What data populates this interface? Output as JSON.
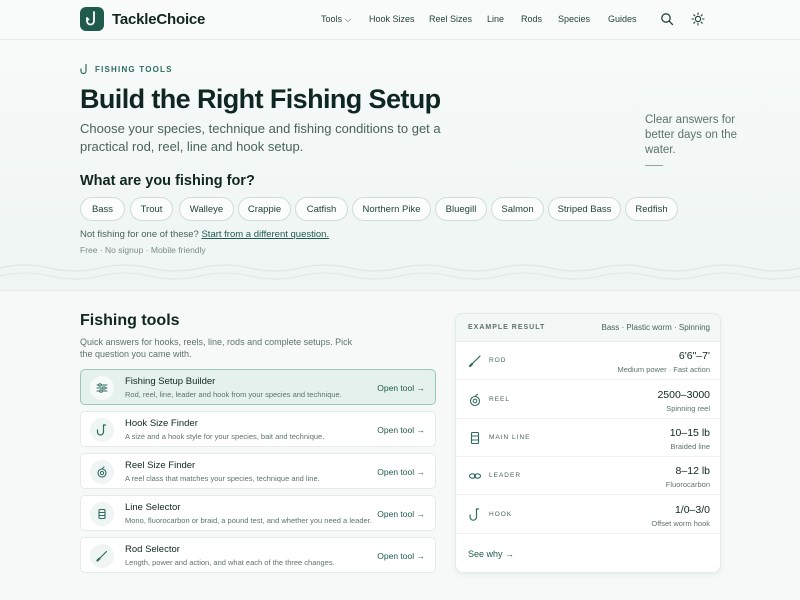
{
  "header": {
    "brand": "TackleChoice",
    "nav": [
      {
        "label": "Tools ⌵"
      },
      {
        "label": "Hook Sizes"
      },
      {
        "label": "Reel Sizes"
      },
      {
        "label": "Line"
      },
      {
        "label": "Rods"
      },
      {
        "label": "Species"
      },
      {
        "label": "Guides"
      }
    ],
    "icons": [
      "search-icon",
      "sun-icon"
    ]
  },
  "hero": {
    "eyebrow": "FISHING TOOLS",
    "title": "Build the Right Fishing Setup",
    "subtitle": "Choose your species, technique and fishing conditions to get a practical rod, reel, line and hook setup.",
    "side_note": "Clear answers for better days on the water.",
    "question": "What are you fishing for?",
    "species": [
      "Bass",
      "Trout",
      "Walleye",
      "Crappie",
      "Catfish",
      "Northern Pike",
      "Bluegill",
      "Salmon",
      "Striped Bass",
      "Redfish"
    ],
    "alt_prefix": "Not fishing for one of these?",
    "alt_link": "Start from a different question.",
    "meta": "Free · No signup · Mobile friendly"
  },
  "tools": {
    "title": "Fishing tools",
    "subtitle": "Quick answers for hooks, reels, line, rods and complete setups. Pick the question you came with.",
    "items": [
      {
        "name": "Fishing Setup Builder",
        "desc": "Rod, reel, line, leader and hook from your species and technique.",
        "open": "Open tool →",
        "icon": "sliders-icon",
        "active": true
      },
      {
        "name": "Hook Size Finder",
        "desc": "A size and a hook style for your species, bait and technique.",
        "open": "Open tool →",
        "icon": "hook-icon",
        "active": false
      },
      {
        "name": "Reel Size Finder",
        "desc": "A reel class that matches your species, technique and line.",
        "open": "Open tool →",
        "icon": "reel-icon",
        "active": false
      },
      {
        "name": "Line Selector",
        "desc": "Mono, fluorocarbon or braid, a pound test, and whether you need a leader.",
        "open": "Open tool →",
        "icon": "spool-icon",
        "active": false
      },
      {
        "name": "Rod Selector",
        "desc": "Length, power and action, and what each of the three changes.",
        "open": "Open tool →",
        "icon": "rod-icon",
        "active": false
      }
    ]
  },
  "example": {
    "label": "EXAMPLE RESULT",
    "context": "Bass · Plastic worm · Spinning",
    "rows": [
      {
        "label": "ROD",
        "value": "6'6\"–7'",
        "note": "Medium power · Fast action",
        "icon": "rod-icon"
      },
      {
        "label": "REEL",
        "value": "2500–3000",
        "note": "Spinning reel",
        "icon": "reel-icon"
      },
      {
        "label": "MAIN LINE",
        "value": "10–15 lb",
        "note": "Braided line",
        "icon": "spool-icon"
      },
      {
        "label": "LEADER",
        "value": "8–12 lb",
        "note": "Fluorocarbon",
        "icon": "leader-icon"
      },
      {
        "label": "HOOK",
        "value": "1/0–3/0",
        "note": "Offset worm hook",
        "icon": "hook-icon"
      }
    ],
    "see_why": "See why →"
  },
  "colors": {
    "brand": "#1f5a4c",
    "accent_bg": "#e4f1ec",
    "text": "#10261f"
  }
}
